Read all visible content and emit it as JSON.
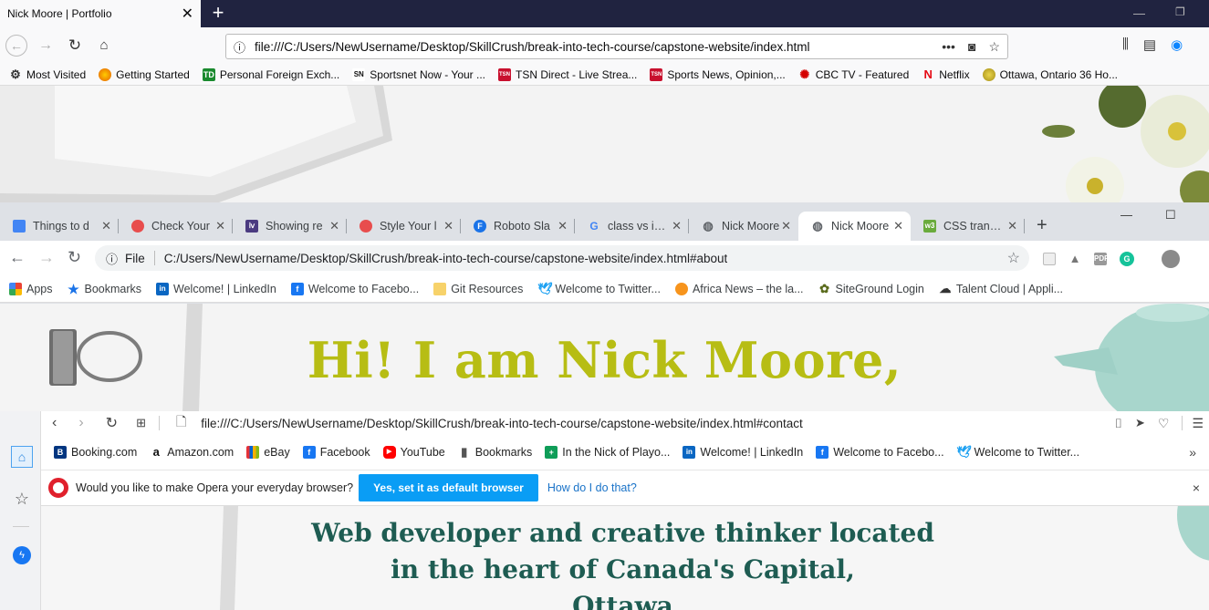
{
  "firefox": {
    "tab_title": "Nick Moore | Portfolio",
    "url": "file:///C:/Users/NewUsername/Desktop/SkillCrush/break-into-tech-course/capstone-website/index.html",
    "bookmarks": [
      {
        "label": "Most Visited",
        "icon": "gear-icon"
      },
      {
        "label": "Getting Started",
        "icon": "firefox-icon"
      },
      {
        "label": "Personal Foreign Exch...",
        "icon": "td-icon"
      },
      {
        "label": "Sportsnet Now - Your ...",
        "icon": "sportsnet-icon"
      },
      {
        "label": "TSN Direct - Live Strea...",
        "icon": "tsn-icon"
      },
      {
        "label": "Sports News, Opinion,...",
        "icon": "tsn-icon"
      },
      {
        "label": "CBC TV - Featured",
        "icon": "cbc-icon"
      },
      {
        "label": "Netflix",
        "icon": "netflix-icon"
      },
      {
        "label": "Ottawa, Ontario 36 Ho...",
        "icon": "weather-icon"
      }
    ]
  },
  "chrome": {
    "tabs": [
      {
        "label": "Things to d",
        "icon": "docs-icon"
      },
      {
        "label": "Check Your",
        "icon": "skillcrush-icon"
      },
      {
        "label": "Showing re",
        "icon": "twitch-icon"
      },
      {
        "label": "Style Your l",
        "icon": "skillcrush-icon"
      },
      {
        "label": "Roboto Sla",
        "icon": "fonts-icon"
      },
      {
        "label": "class vs id c",
        "icon": "google-icon"
      },
      {
        "label": "Nick Moore",
        "icon": "globe-icon"
      },
      {
        "label": "Nick Moore",
        "icon": "globe-icon"
      },
      {
        "label": "CSS transfo",
        "icon": "w3-icon"
      }
    ],
    "omnibox_prefix": "File",
    "url": "C:/Users/NewUsername/Desktop/SkillCrush/break-into-tech-course/capstone-website/index.html#about",
    "bookmarks": [
      {
        "label": "Apps",
        "icon": "apps-icon"
      },
      {
        "label": "Bookmarks",
        "icon": "star-icon"
      },
      {
        "label": "Welcome! | LinkedIn",
        "icon": "linkedin-icon"
      },
      {
        "label": "Welcome to Facebo...",
        "icon": "facebook-icon"
      },
      {
        "label": "Git Resources",
        "icon": "folder-icon"
      },
      {
        "label": "Welcome to Twitter...",
        "icon": "twitter-icon"
      },
      {
        "label": "Africa News – the la...",
        "icon": "africanews-icon"
      },
      {
        "label": "SiteGround Login",
        "icon": "siteground-icon"
      },
      {
        "label": "Talent Cloud | Appli...",
        "icon": "cloud-icon"
      }
    ],
    "hero_title": "Hi! I am Nick Moore,"
  },
  "opera": {
    "url": "file:///C:/Users/NewUsername/Desktop/SkillCrush/break-into-tech-course/capstone-website/index.html#contact",
    "bookmarks": [
      {
        "label": "Booking.com",
        "icon": "booking-icon"
      },
      {
        "label": "Amazon.com",
        "icon": "amazon-icon"
      },
      {
        "label": "eBay",
        "icon": "ebay-icon"
      },
      {
        "label": "Facebook",
        "icon": "facebook-icon"
      },
      {
        "label": "YouTube",
        "icon": "youtube-icon"
      },
      {
        "label": "Bookmarks",
        "icon": "bookmark-icon"
      },
      {
        "label": "In the Nick of Playo...",
        "icon": "sheets-icon"
      },
      {
        "label": "Welcome! | LinkedIn",
        "icon": "linkedin-icon"
      },
      {
        "label": "Welcome to Facebo...",
        "icon": "facebook-icon"
      },
      {
        "label": "Welcome to Twitter...",
        "icon": "twitter-icon"
      }
    ],
    "default_prompt": "Would you like to make Opera your everyday browser?",
    "default_button": "Yes, set it as default browser",
    "default_link": "How do I do that?",
    "heading_lines": [
      "Web developer and creative thinker located",
      "in the heart of Canada's Capital,",
      "Ottawa"
    ]
  }
}
